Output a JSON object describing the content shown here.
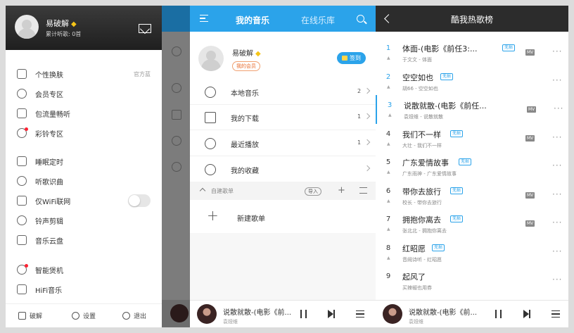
{
  "drawer": {
    "username": "易破解",
    "listen_stat": "累计听歌: 0首",
    "menu": [
      {
        "label": "个性换肤",
        "right": "官方蓝",
        "icon": "shirt-icon"
      },
      {
        "label": "会员专区",
        "right": "",
        "icon": "vip-icon"
      },
      {
        "label": "包流量畅听",
        "right": "",
        "icon": "data-package-icon"
      },
      {
        "label": "彩铃专区",
        "right": "",
        "icon": "bell-icon",
        "dot": true
      },
      {
        "label": "睡眠定时",
        "right": "",
        "icon": "timer-icon"
      },
      {
        "label": "听歌识曲",
        "right": "",
        "icon": "recognize-icon"
      },
      {
        "label": "仅WiFi联网",
        "right": "",
        "icon": "wifi-icon",
        "toggle": true
      },
      {
        "label": "铃声剪辑",
        "right": "",
        "icon": "ringtone-cut-icon"
      },
      {
        "label": "音乐云盘",
        "right": "",
        "icon": "cloud-icon"
      },
      {
        "label": "智能煲机",
        "right": "",
        "icon": "burn-in-icon",
        "dot": true
      },
      {
        "label": "HiFi音乐",
        "right": "",
        "icon": "hifi-icon"
      }
    ],
    "footer": {
      "crack": "破解",
      "settings": "设置",
      "logout": "退出"
    }
  },
  "my_music": {
    "tab_active": "我的音乐",
    "tab_online": "在线乐库",
    "username": "易破解",
    "badge": "我的会员",
    "sign_in": "签到",
    "rows": [
      {
        "label": "本地音乐",
        "count": "2",
        "icon": "disc-icon"
      },
      {
        "label": "我的下载",
        "count": "1",
        "icon": "download-icon"
      },
      {
        "label": "最近播放",
        "count": "1",
        "icon": "clock-icon"
      },
      {
        "label": "我的收藏",
        "count": "",
        "icon": "heart-icon"
      }
    ],
    "section": {
      "label": "自建歌单",
      "import": "导入"
    },
    "new_playlist": "新建歌单"
  },
  "player": {
    "title": "说散就散-(电影《前...",
    "artist": "袁娅维"
  },
  "charts": {
    "title": "酷我热歌榜",
    "loss_tag": "无损",
    "mv_tag": "MV",
    "songs": [
      {
        "rank": "1",
        "name": "体面-(电影《前任3:...",
        "artist": "于文文 - 体面",
        "loss": true,
        "mv": true
      },
      {
        "rank": "2",
        "name": "空空如也",
        "artist": "胡66 - 空空如也",
        "loss": true,
        "mv": false
      },
      {
        "rank": "3",
        "name": "说散就散-(电影《前任...",
        "artist": "袁娅维 - 说散就散",
        "loss": false,
        "mv": true
      },
      {
        "rank": "4",
        "name": "我们不一样",
        "artist": "大壮 - 我们不一样",
        "loss": true,
        "mv": true
      },
      {
        "rank": "5",
        "name": "广东爱情故事",
        "artist": "广东雨神 - 广东爱情故事",
        "loss": true,
        "mv": false
      },
      {
        "rank": "6",
        "name": "带你去旅行",
        "artist": "校长 - 带你去旅行",
        "loss": true,
        "mv": true
      },
      {
        "rank": "7",
        "name": "拥抱你离去",
        "artist": "张北北 - 拥抱你离去",
        "loss": true,
        "mv": true
      },
      {
        "rank": "8",
        "name": "红昭愿",
        "artist": "音阙诗听 - 红昭愿",
        "loss": true,
        "mv": false
      },
      {
        "rank": "9",
        "name": "起风了",
        "artist": "买辣椒也用券",
        "loss": false,
        "mv": false
      }
    ]
  }
}
